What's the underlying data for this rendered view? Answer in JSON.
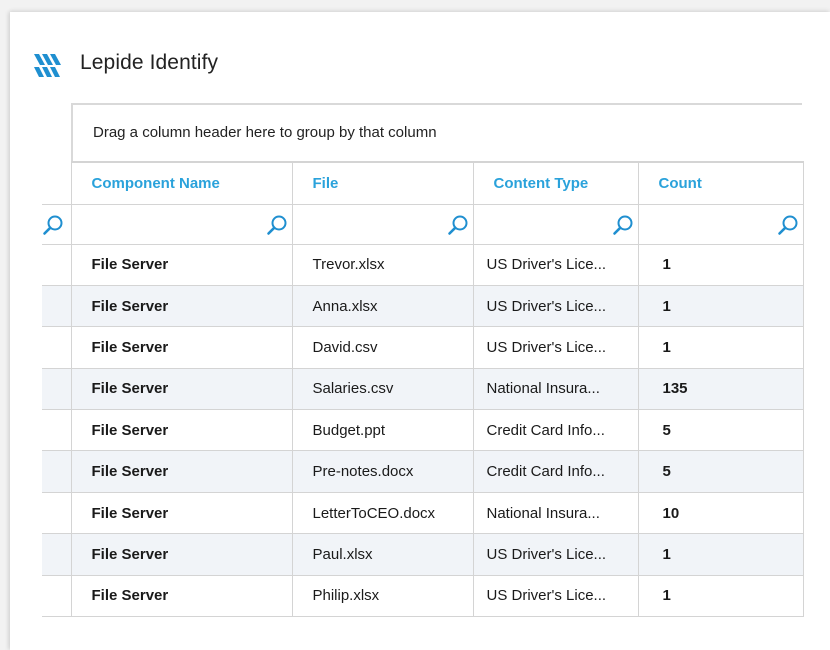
{
  "app": {
    "title": "Lepide Identify",
    "logo_icon": "lepide-logo-icon",
    "accent_color": "#2aa2db"
  },
  "grid": {
    "group_hint": "Drag a column header here to group by that column",
    "columns": [
      "Component Name",
      "File",
      "Content Type",
      "Count"
    ],
    "filter_icon": "search-icon",
    "rows": [
      {
        "component": "File Server",
        "file": "Trevor.xlsx",
        "content_type": "US Driver's Lice...",
        "count": "1"
      },
      {
        "component": "File Server",
        "file": "Anna.xlsx",
        "content_type": "US Driver's Lice...",
        "count": "1"
      },
      {
        "component": "File Server",
        "file": "David.csv",
        "content_type": "US Driver's Lice...",
        "count": "1"
      },
      {
        "component": "File Server",
        "file": "Salaries.csv",
        "content_type": "National Insura...",
        "count": "135"
      },
      {
        "component": "File Server",
        "file": "Budget.ppt",
        "content_type": "Credit Card Info...",
        "count": "5"
      },
      {
        "component": "File Server",
        "file": "Pre-notes.docx",
        "content_type": "Credit Card Info...",
        "count": "5"
      },
      {
        "component": "File Server",
        "file": "LetterToCEO.docx",
        "content_type": "National Insura...",
        "count": "10"
      },
      {
        "component": "File Server",
        "file": "Paul.xlsx",
        "content_type": "US Driver's Lice...",
        "count": "1"
      },
      {
        "component": "File Server",
        "file": "Philip.xlsx",
        "content_type": "US Driver's Lice...",
        "count": "1"
      }
    ]
  }
}
